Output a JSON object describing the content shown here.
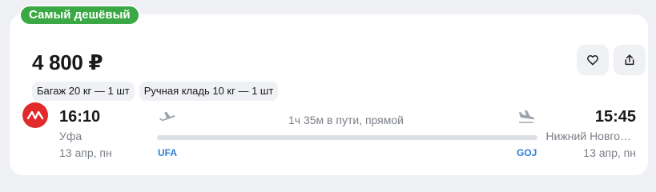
{
  "badge": {
    "label": "Самый дешёвый",
    "color": "#3aa845"
  },
  "offer": {
    "price": "4 800 ₽",
    "tags": [
      {
        "label": "Багаж 20 кг — 1 шт"
      },
      {
        "label": "Ручная кладь 10 кг — 1 шт"
      }
    ],
    "actions": {
      "favorite_icon": "heart-icon",
      "share_icon": "share-icon"
    }
  },
  "flight": {
    "airline_logo_color": "#e22a2a",
    "departure": {
      "time": "16:10",
      "city": "Уфа",
      "date": "13 апр, пн",
      "iata": "UFA"
    },
    "arrival": {
      "time": "15:45",
      "city": "Нижний Новго…",
      "date": "13 апр, пн",
      "iata": "GOJ"
    },
    "duration": "1ч 35м в пути, прямой",
    "iata_color": "#2f7fd6"
  }
}
